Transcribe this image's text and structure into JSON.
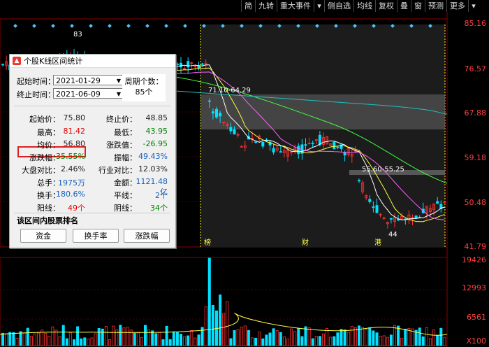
{
  "toolbar": {
    "items": [
      "简",
      "九转",
      "重大事件",
      "▾",
      "侧自选",
      "均线",
      "复权",
      "叠",
      "窗",
      "预测",
      "更多",
      "▾"
    ]
  },
  "chart": {
    "price_axis": [
      "85.16",
      "76.57",
      "67.88",
      "59.18",
      "50.48",
      "41.79"
    ],
    "volume_axis": [
      "19426",
      "12993",
      "6561",
      "X100"
    ],
    "high_marker": "83",
    "low_marker": "44",
    "band_label_1": "71.10-64.29",
    "band_label_2": "55.60-55.25",
    "markers": [
      "榜",
      "财",
      "港"
    ],
    "colors": {
      "up": "#ff3030",
      "down": "#00e0ff",
      "ma5": "#ffffff",
      "ma10": "#ffff40",
      "ma20": "#ff60ff",
      "ma60": "#40ff40",
      "ma120": "#20c0c0"
    }
  },
  "dialog": {
    "title": "个股K线区间统计",
    "start_label": "起始时间：",
    "start_value": "2021-01-29",
    "end_label": "终止时间：",
    "end_value": "2021-06-09",
    "period_label": "周期个数：",
    "period_value": "85个",
    "stats": [
      {
        "l1": "起始价：",
        "v1": "75.80",
        "c1": "dark",
        "l2": "终止价：",
        "v2": "48.85",
        "c2": "dark"
      },
      {
        "l1": "最高：",
        "v1": "81.42",
        "c1": "red",
        "l2": "最低：",
        "v2": "43.95",
        "c2": "green"
      },
      {
        "l1": "均价：",
        "v1": "56.80",
        "c1": "dark",
        "l2": "涨跌值：",
        "v2": "-26.95",
        "c2": "green"
      },
      {
        "l1": "涨跌幅：",
        "v1": "-35.55%",
        "c1": "green",
        "l2": "振幅：",
        "v2": "49.43%",
        "c2": "blue"
      },
      {
        "l1": "大盘对比：",
        "v1": "2.46%",
        "c1": "dark",
        "l2": "行业对比：",
        "v2": "12.03%",
        "c2": "dark"
      },
      {
        "l1": "总手：",
        "v1": "1975万",
        "c1": "blue",
        "l2": "金额：",
        "v2": "1121.48亿",
        "c2": "blue"
      },
      {
        "l1": "换手：",
        "v1": "180.6%",
        "c1": "blue",
        "l2": "平线：",
        "v2": "2个",
        "c2": "blue"
      },
      {
        "l1": "阳线：",
        "v1": "49个",
        "c1": "red",
        "l2": "阴线：",
        "v2": "34个",
        "c2": "green"
      }
    ],
    "ranking_title": "该区间内股票排名",
    "btn_capital": "资金",
    "btn_turnover": "换手率",
    "btn_change": "涨跌幅"
  }
}
